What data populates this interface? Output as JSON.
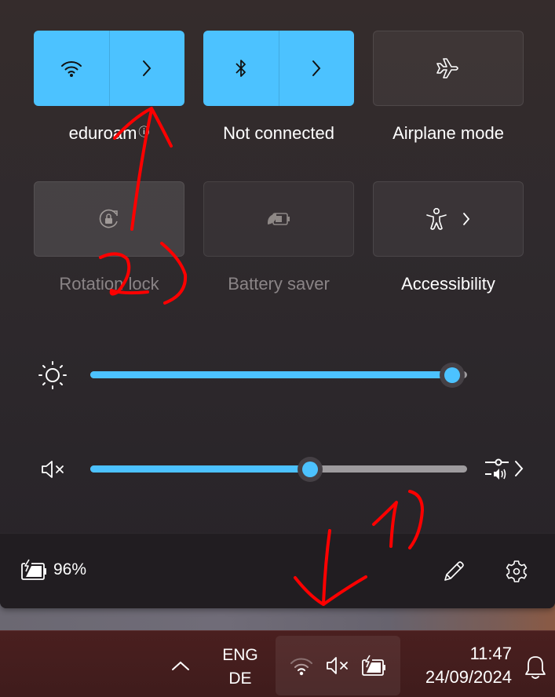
{
  "quick_settings": {
    "tiles": [
      {
        "id": "wifi",
        "label": "eduroam",
        "label_suffix_icon": "info-icon",
        "state": "on",
        "icon": "wifi-icon",
        "has_expand": true
      },
      {
        "id": "bluetooth",
        "label": "Not connected",
        "state": "on",
        "icon": "bluetooth-icon",
        "has_expand": true
      },
      {
        "id": "airplane",
        "label": "Airplane mode",
        "state": "off",
        "icon": "airplane-icon",
        "has_expand": false
      },
      {
        "id": "rotation-lock",
        "label": "Rotation lock",
        "state": "disabled",
        "icon": "rotation-lock-icon",
        "has_expand": false
      },
      {
        "id": "battery-saver",
        "label": "Battery saver",
        "state": "disabled",
        "icon": "battery-saver-icon",
        "has_expand": false
      },
      {
        "id": "accessibility",
        "label": "Accessibility",
        "state": "off",
        "icon": "accessibility-icon",
        "has_expand": true
      }
    ],
    "sliders": {
      "brightness": {
        "icon": "brightness-icon",
        "value_percent": 100
      },
      "volume": {
        "icon": "volume-muted-icon",
        "value_percent": 59,
        "muted": true,
        "extra_icon": "audio-output-icon"
      }
    },
    "footer": {
      "battery_icon": "battery-charging-icon",
      "battery_text": "96%",
      "edit_icon": "pencil-icon",
      "settings_icon": "gear-icon"
    },
    "accent_color": "#4cc2ff"
  },
  "annotations": {
    "color": "#ff0000",
    "labels": [
      "1)",
      "2)"
    ]
  },
  "taskbar": {
    "overflow_icon": "chevron-up-icon",
    "language_line1": "ENG",
    "language_line2": "DE",
    "tray_icons": [
      "wifi-icon",
      "volume-muted-icon",
      "battery-charging-icon"
    ],
    "time": "11:47",
    "date": "24/09/2024",
    "notification_icon": "bell-icon"
  }
}
